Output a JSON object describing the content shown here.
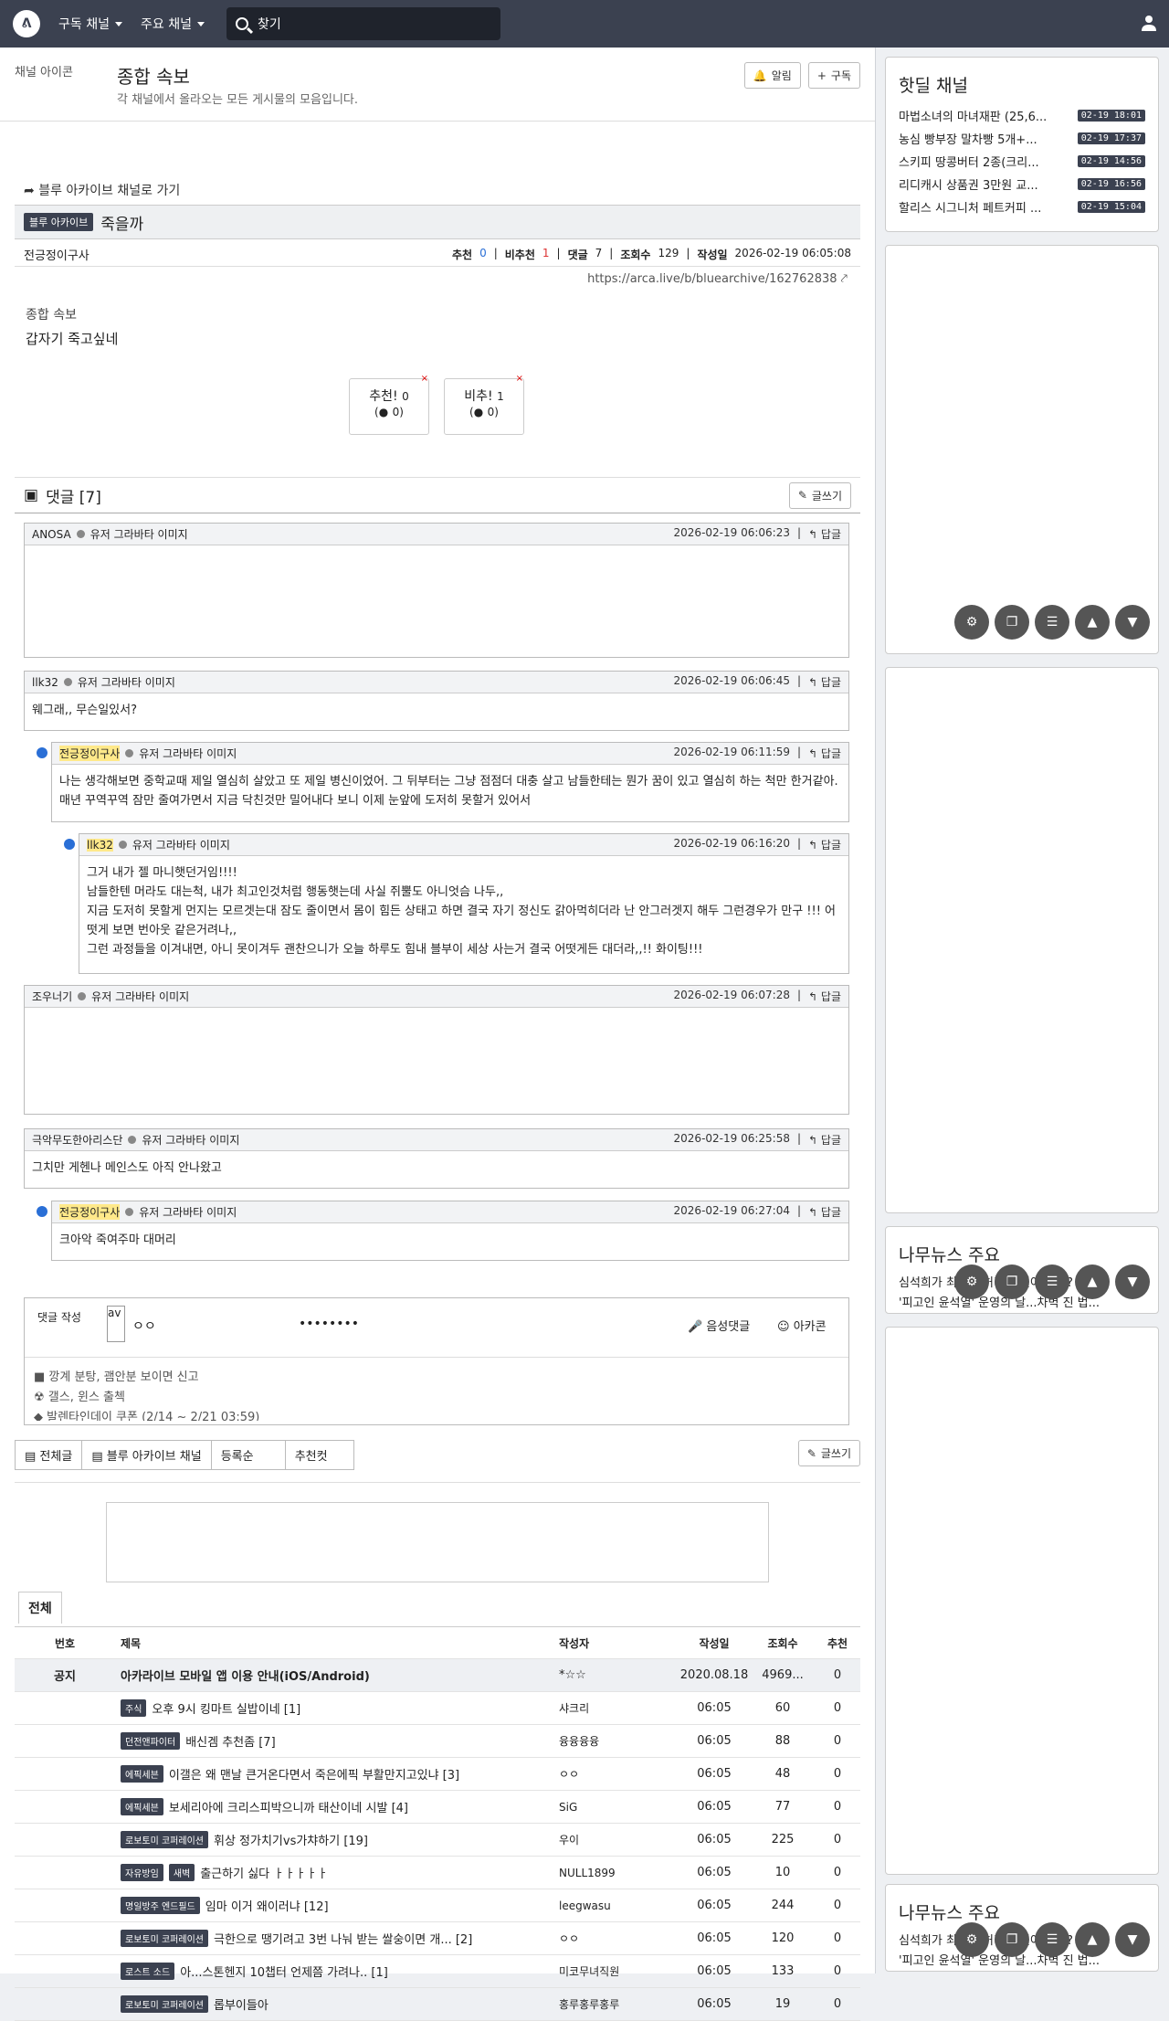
{
  "nav": {
    "subscribed": "구독 채널",
    "main": "주요 채널",
    "search": "찾기"
  },
  "channel": {
    "icon_alt": "채널 아이콘",
    "title": "종합 속보",
    "desc": "각 채널에서 올라오는 모든 게시물의 모음입니다.",
    "notify": "알림",
    "subscribe": "구독"
  },
  "post": {
    "back": "블루 아카이브 채널로 가기",
    "badge": "블루 아카이브",
    "title": "죽을까",
    "author": "전긍정이구사",
    "up_label": "추천",
    "up": "0",
    "down_label": "비추천",
    "down": "1",
    "comments_label": "댓글",
    "comments": "7",
    "views_label": "조회수",
    "views": "129",
    "date_label": "작성일",
    "date": "2026-02-19 06:05:08",
    "url": "https://arca.live/b/bluearchive/162762838",
    "img_alt": "종합 속보",
    "body": "갑자기 죽고싶네",
    "vote_up": "추천!",
    "vote_down": "비추!",
    "vote_up_n": "0",
    "vote_down_n": "1",
    "vote_up_sub": "0",
    "vote_down_sub": "0"
  },
  "comments": {
    "title": "댓글 [7]",
    "write": "글쓰기",
    "reply": "답글",
    "avatar_alt": "유저 그라바타 이미지",
    "items": [
      {
        "author": "ANOSA",
        "date": "2026-02-19 06:06:23",
        "text": ""
      },
      {
        "author": "llk32",
        "date": "2026-02-19 06:06:45",
        "text": "웨그래,, 무슨일있서?"
      },
      {
        "author": "전긍정이구사",
        "date": "2026-02-19 06:11:59",
        "text": "나는 생각해보면 중학교때 제일 열심히 살았고 또 제일 병신이었어. 그 뒤부터는 그냥 점점더 대충 살고 남들한테는 뭔가 꿈이 있고 열심히 하는 척만 한거같아. 매년 꾸역꾸역 잠만 줄여가면서 지금 닥친것만 밀어내다 보니 이제 눈앞에 도저히 못할거 있어서"
      },
      {
        "author": "llk32",
        "date": "2026-02-19 06:16:20",
        "text": "그거 내가 젤 마니햇던거임!!!!\n남들한텐 머라도 대는척, 내가 최고인것처럼 행동햇는데 사실 쥐뿔도 아니엇슴 나두,,\n지금 도저히 못할게 먼지는 모르겟는대 잠도 줄이면서 몸이 힘든 상태고 하면 결국 자기 정신도 갉아먹히더라 난 안그러겟지 해두 그런경우가 만구 !!! 어떳게 보면 번아웃 같은거려나,,\n그런 과정들을 이겨내면, 아니 못이겨두 괜찬으니가 오늘 하루도 힘내 블부이 세상 사는거 결국 어떳게든 대더라,,!! 화이팅!!!"
      },
      {
        "author": "조우너기",
        "date": "2026-02-19 06:07:28",
        "text": ""
      },
      {
        "author": "극악무도한아리스단",
        "date": "2026-02-19 06:25:58",
        "text": "그치만 게헨나 메인스도 아직 안나왔고"
      },
      {
        "author": "전긍정이구사",
        "date": "2026-02-19 06:27:04",
        "text": "크아악 죽여주마 대머리"
      }
    ]
  },
  "write": {
    "label": "댓글 작성",
    "avatar": "av",
    "name": "ㅇㅇ",
    "pw": "••••••••",
    "voice": "음성댓글",
    "arcacon": "아카콘",
    "rules": [
      "깡계 분탕, 괨안분 보이면 신고",
      "갤스, 윈스 출첵",
      "발렌타인데이 쿠폰 (2/14 ~ 2/21 03:59)"
    ]
  },
  "tabs": [
    "전체글",
    "블루 아카이브 채널",
    "등록순",
    "추천컷"
  ],
  "list": {
    "tab": "전체",
    "headers": [
      "번호",
      "제목",
      "작성자",
      "작성일",
      "조회수",
      "추천"
    ],
    "notice": {
      "n": "공지",
      "title": "아카라이브 모바일 앱 이용 안내(iOS/Android)",
      "author": "*☆☆",
      "date": "2020.08.18",
      "views": "4969...",
      "rec": "0"
    },
    "rows": [
      {
        "badges": [
          "주식"
        ],
        "title": "오후 9시 킹마트 실밥이네 [1]",
        "author": "샤크리",
        "date": "06:05",
        "views": "60",
        "rec": "0"
      },
      {
        "badges": [
          "던전앤파이터"
        ],
        "title": "배신겜 추천좀 [7]",
        "author": "융융융융",
        "date": "06:05",
        "views": "88",
        "rec": "0"
      },
      {
        "badges": [
          "에픽세븐"
        ],
        "title": "이갤은 왜 맨날 큰거온다면서 죽은에픽 부활만지고있냐 [3]",
        "author": "ㅇㅇ",
        "date": "06:05",
        "views": "48",
        "rec": "0"
      },
      {
        "badges": [
          "에픽세븐"
        ],
        "title": "보세리아에 크리스피박으니까 태산이네 시발 [4]",
        "author": "SiG",
        "date": "06:05",
        "views": "77",
        "rec": "0"
      },
      {
        "badges": [
          "로보토미 코퍼레이션"
        ],
        "title": "휘상 정가치기vs가챠하기 [19]",
        "author": "우이",
        "date": "06:05",
        "views": "225",
        "rec": "0"
      },
      {
        "badges": [
          "자유방임",
          "새벽"
        ],
        "title": "출근하기 싫다 ㅏㅏㅏㅏㅏ",
        "author": "NULL1899",
        "date": "06:05",
        "views": "10",
        "rec": "0"
      },
      {
        "badges": [
          "명일방주 엔드필드"
        ],
        "title": "임마 이거 왜이러냐 [12]",
        "author": "leegwasu",
        "date": "06:05",
        "views": "244",
        "rec": "0"
      },
      {
        "badges": [
          "로보토미 코퍼레이션"
        ],
        "title": "극한으로 땡기려고 3번 나눠 받는 쌀숭이면 개... [2]",
        "author": "ㅇㅇ",
        "date": "06:05",
        "views": "120",
        "rec": "0"
      },
      {
        "badges": [
          "로스트 소드"
        ],
        "title": "아...스톤헨지 10챕터 언제쯤 가려나.. [1]",
        "author": "미코무녀직원",
        "date": "06:05",
        "views": "133",
        "rec": "0"
      },
      {
        "badges": [
          "로보토미 코퍼레이션"
        ],
        "title": "롭부이들아",
        "author": "홍루홍루홍루",
        "date": "06:05",
        "views": "19",
        "rec": "0"
      }
    ]
  },
  "side": {
    "hot_title": "핫딜 채널",
    "hot": [
      {
        "t": "마법소녀의 마녀재판 (25,6...",
        "d": "02-19 18:01"
      },
      {
        "t": "농심 빵부장 말차빵 5개+...",
        "d": "02-19 17:37"
      },
      {
        "t": "스키피 땅콩버터 2종(크리...",
        "d": "02-19 14:56"
      },
      {
        "t": "리디캐시 상품권 3만원 교...",
        "d": "02-19 16:56"
      },
      {
        "t": "할리스 시그니처 페트커피 ...",
        "d": "02-19 15:04"
      }
    ],
    "news_title": "나무뉴스 주요",
    "news": [
      "심석희가 최민정 허리를 밀어 준다? 화려...",
      "'피고인 윤석열' 운영의 날...차벽 진 법..."
    ]
  }
}
